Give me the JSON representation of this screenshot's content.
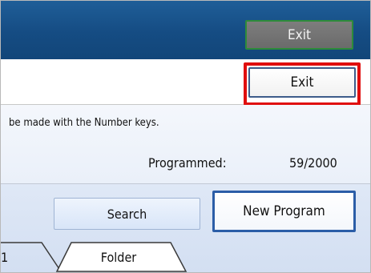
{
  "header": {
    "exit_label": "Exit"
  },
  "toolbar": {
    "exit_label": "Exit"
  },
  "info": {
    "hint_text": "be made with the Number keys.",
    "programmed_label": "Programmed:",
    "programmed_value": "59/2000"
  },
  "actions": {
    "search_label": "Search",
    "new_program_label": "New Program"
  },
  "tabs": [
    {
      "label": "1"
    },
    {
      "label": "Folder"
    }
  ],
  "colors": {
    "titlebar": "#1a5690",
    "highlight": "#e00e0e",
    "accent_border": "#2b5da7"
  }
}
